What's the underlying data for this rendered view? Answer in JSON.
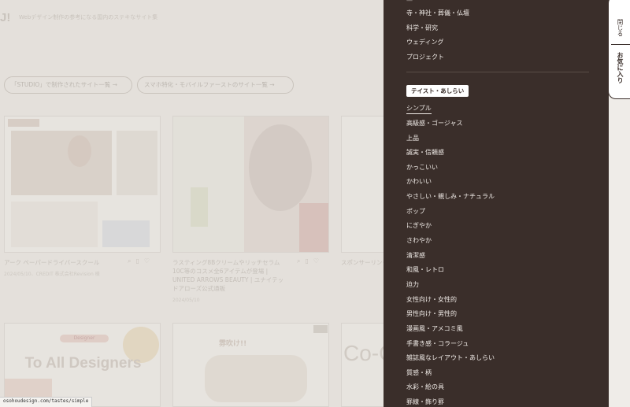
{
  "header": {
    "logo": "J!",
    "tagline": "Webデザイン制作の参考になる国内のステキなサイト集"
  },
  "filters": [
    "「STUDIO」で制作されたサイト一覧 →",
    "スマホ特化・モバイルファーストのサイト一覧 →"
  ],
  "cards": [
    {
      "title": "アーク ペーパードライバースクール",
      "meta": "2024/05/10、CREDIT 株式会社Revision 様"
    },
    {
      "title": "ラスティング8Bクリームやリッチセラム10C等のコスメ全6アイテムが登場 | UNITED ARROWS BEAUTY | ユナイテッドアローズ公式通販",
      "meta": "2024/05/10"
    },
    {
      "title": "スポンサーリンク",
      "meta": ""
    },
    {
      "art_text": "To All Designers",
      "art_badge": "Designer"
    },
    {
      "art_text": "雰吹け!!"
    },
    {
      "art_text": "Co-C"
    }
  ],
  "status_bar": {
    "url": "osohoudesign.com/tastes/simple"
  },
  "drawer": {
    "top_items": [
      "寺・神社・葬儀・仏壇",
      "科学・研究",
      "ウェディング",
      "プロジェクト"
    ],
    "section_label": "テイスト・あしらい",
    "taste_items": [
      "シンプル",
      "高級感・ゴージャス",
      "上品",
      "誠実・信頼感",
      "かっこいい",
      "かわいい",
      "やさしい・親しみ・ナチュラル",
      "ポップ",
      "にぎやか",
      "さわやか",
      "清潔感",
      "和風・レトロ",
      "迫力",
      "女性向け・女性的",
      "男性向け・男性的",
      "漫画風・アメコミ風",
      "手書き感・コラージュ",
      "雑誌風なレイアウト・あしらい",
      "質感・柄",
      "水彩・絵の具",
      "罫線・飾り罫"
    ],
    "active_item": "シンプル"
  },
  "side_tab": {
    "close_label": "閉じる",
    "favorites_label": "お気に入り"
  },
  "colors": {
    "drawer_bg": "#3a2e2a",
    "page_bg": "#efece8"
  }
}
